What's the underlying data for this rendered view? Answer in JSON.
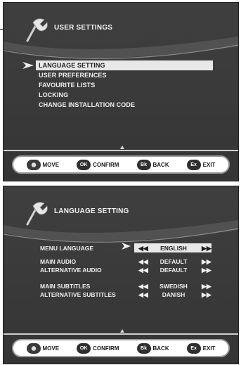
{
  "screen1": {
    "title": "USER SETTINGS",
    "menu": [
      {
        "label": "LANGUAGE SETTING",
        "selected": true
      },
      {
        "label": "USER PREFERENCES",
        "selected": false
      },
      {
        "label": "FAVOURITE LISTS",
        "selected": false
      },
      {
        "label": "LOCKING",
        "selected": false
      },
      {
        "label": "CHANGE INSTALLATION CODE",
        "selected": false
      }
    ],
    "footer": [
      {
        "key": "",
        "icon": "dpad-icon",
        "label": "MOVE"
      },
      {
        "key": "OK",
        "label": "CONFIRM"
      },
      {
        "key": "Bk",
        "label": "BACK"
      },
      {
        "key": "Ex",
        "label": "EXIT"
      }
    ]
  },
  "screen2": {
    "title": "LANGUAGE SETTING",
    "rows": [
      {
        "label": "MENU LANGUAGE",
        "value": "ENGLISH",
        "selected": true
      },
      {
        "label": "MAIN AUDIO",
        "value": "DEFAULT",
        "selected": false
      },
      {
        "label": "ALTERNATIVE AUDIO",
        "value": "DEFAULT",
        "selected": false
      },
      {
        "label": "MAIN SUBTITLES",
        "value": "SWEDISH",
        "selected": false
      },
      {
        "label": "ALTERNATIVE SUBTITLES",
        "value": "DANISH",
        "selected": false
      }
    ],
    "arrows": {
      "left": "◀◀",
      "right": "▶▶"
    },
    "footer": [
      {
        "key": "",
        "icon": "dpad-icon",
        "label": "MOVE"
      },
      {
        "key": "OK",
        "label": "CONFIRM"
      },
      {
        "key": "Bk",
        "label": "BACK"
      },
      {
        "key": "Ex",
        "label": "EXIT"
      }
    ]
  },
  "colors": {
    "screen_bg": "#3c3c3c",
    "highlight": "#e8e8e8",
    "text": "#f0f0f0"
  }
}
